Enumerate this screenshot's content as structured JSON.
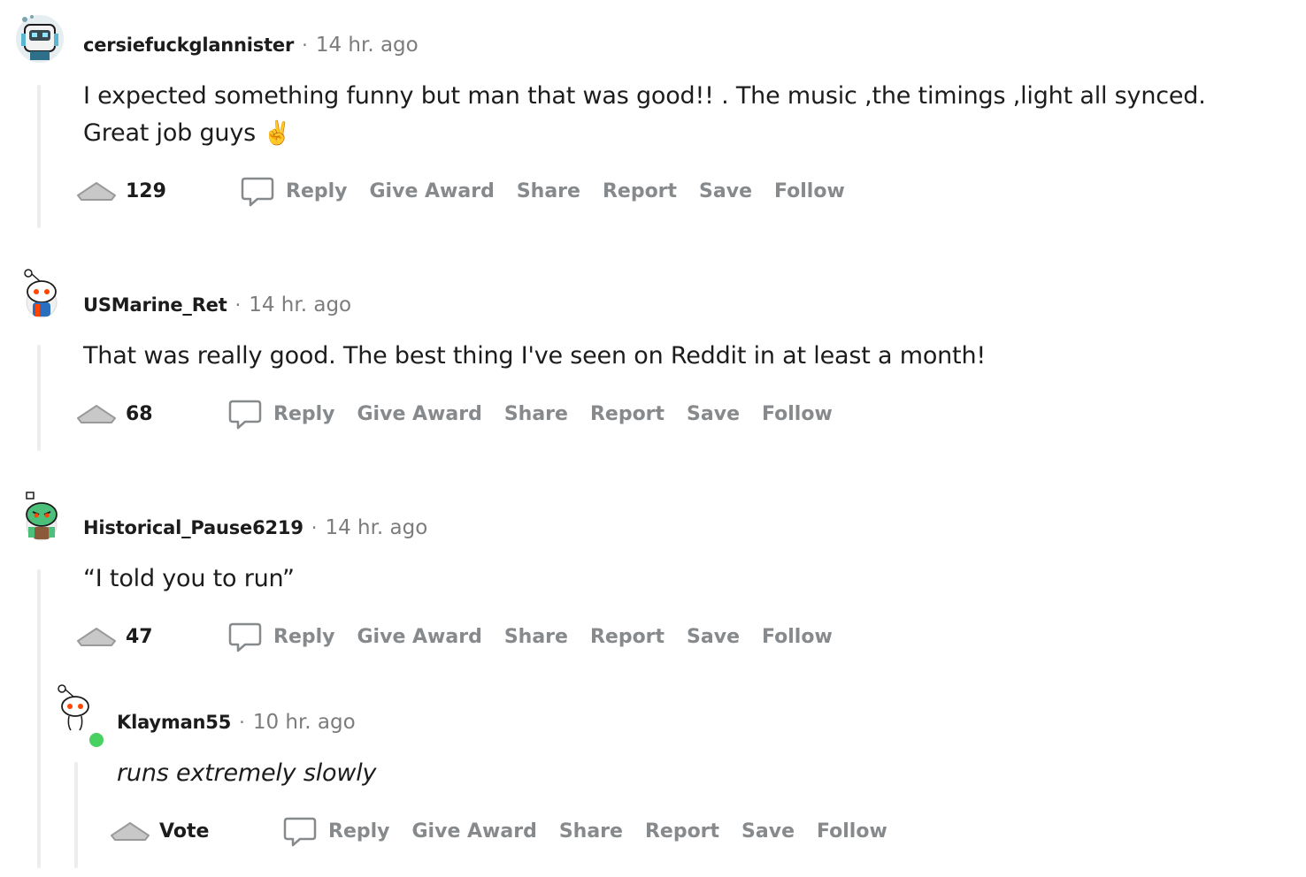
{
  "colors": {
    "meta_gray": "#7c7c7c",
    "action_gray": "#878a8c",
    "thread_line": "#ededed",
    "vote_fill": "#c8c8c8",
    "online_green": "#46d160"
  },
  "actions": {
    "reply": "Reply",
    "give_award": "Give Award",
    "share": "Share",
    "report": "Report",
    "save": "Save",
    "follow": "Follow"
  },
  "comments": [
    {
      "author": "cersiefuckglannister",
      "separator": "·",
      "time": "14 hr. ago",
      "body": "I expected something funny but man that was good!! . The music ,the timings ,light all synced. Great job guys",
      "emoji": "✌️",
      "votes": "129",
      "avatar_icon": "robot-avatar-icon"
    },
    {
      "author": "USMarine_Ret",
      "separator": "·",
      "time": "14 hr. ago",
      "body": "That was really good. The best thing I've seen on Reddit in at least a month!",
      "votes": "68",
      "avatar_icon": "snoo-avatar-icon"
    },
    {
      "author": "Historical_Pause6219",
      "separator": "·",
      "time": "14 hr. ago",
      "body": "“I told you to run”",
      "votes": "47",
      "avatar_icon": "green-snoo-avatar-icon"
    },
    {
      "author": "Klayman55",
      "separator": "·",
      "time": "10 hr. ago",
      "body": "runs extremely slowly",
      "votes": "Vote",
      "avatar_icon": "snoo-online-avatar-icon"
    }
  ]
}
